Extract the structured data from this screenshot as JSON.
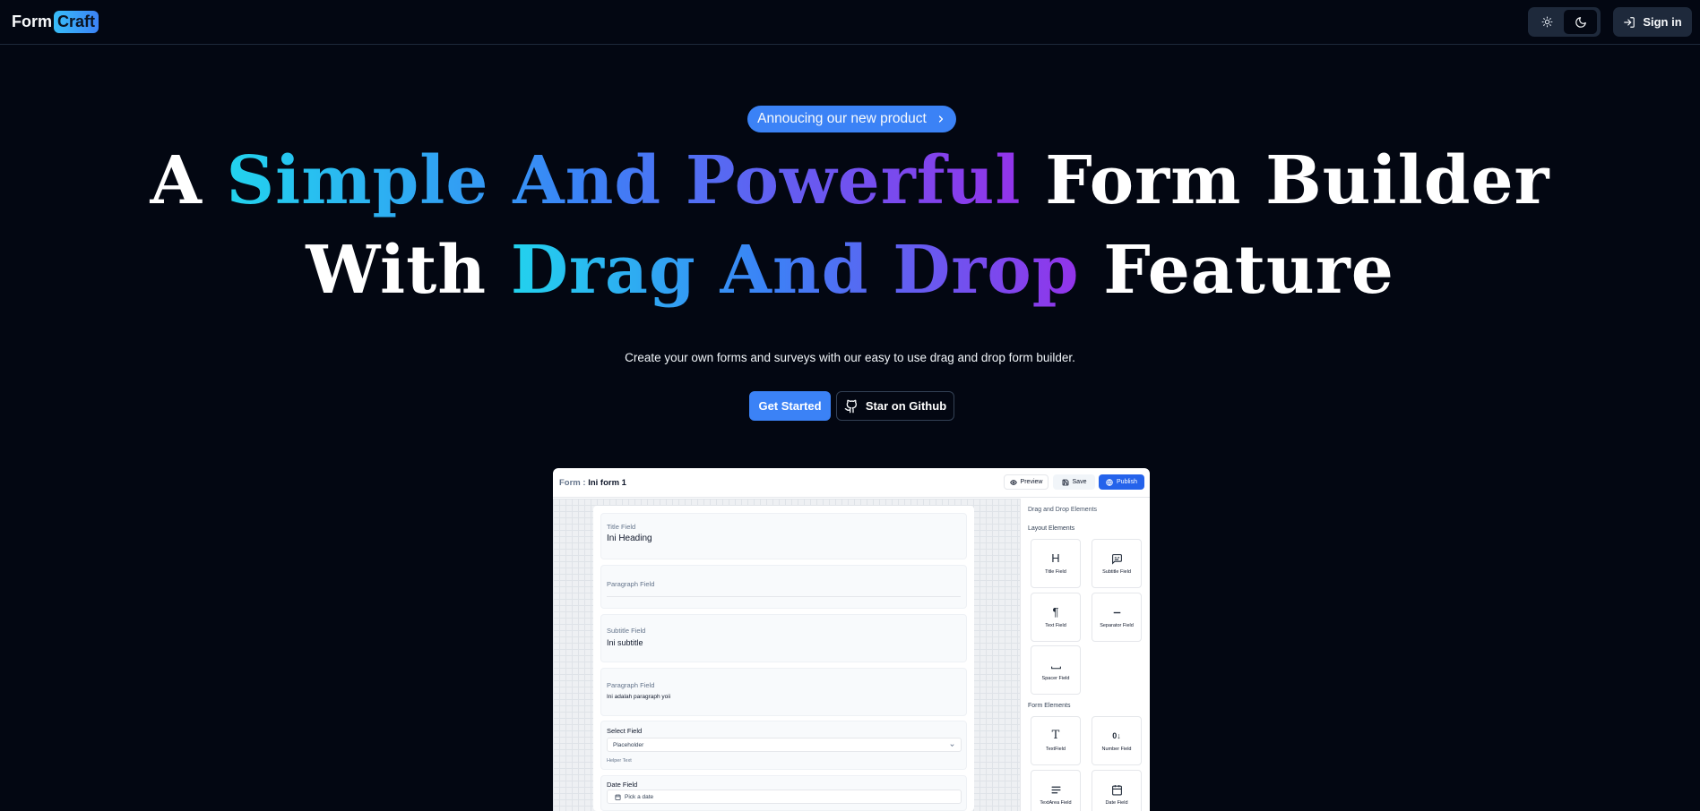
{
  "nav": {
    "logo_form": "Form",
    "logo_craft": "Craft",
    "signin_label": "Sign in"
  },
  "hero": {
    "badge": "Annoucing our new product",
    "headline_line1": [
      "A",
      "Simple And Powerful",
      "Form Builder"
    ],
    "headline_line2": [
      "With",
      "Drag And Drop",
      "Feature"
    ],
    "subtitle": "Create your own forms and surveys with our easy to use drag and drop form builder.",
    "cta_primary": "Get Started",
    "cta_secondary": "Star on Github"
  },
  "preview": {
    "form_prefix": "Form :",
    "form_name": "Ini form 1",
    "btn_preview": "Preview",
    "btn_save": "Save",
    "btn_publish": "Publish",
    "fields": [
      {
        "label": "Title Field",
        "value": "Ini Heading"
      },
      {
        "label": "Paragraph Field",
        "value": ""
      },
      {
        "label": "Subtitle Field",
        "value": "Ini subtitle"
      },
      {
        "label": "Paragraph Field",
        "value": "Ini adalah paragraph yoii"
      },
      {
        "label": "Select Field",
        "placeholder": "Placeholder",
        "helper": "Helper Text"
      },
      {
        "label": "Date Field",
        "placeholder": "Pick a date"
      }
    ],
    "sidebar": {
      "title": "Drag and Drop Elements",
      "layout_heading": "Layout Elements",
      "form_heading": "Form Elements",
      "layout_elements": [
        "Title Field",
        "Subtitle Field",
        "Text Field",
        "Separator Field",
        "Spacer Field"
      ],
      "form_elements": [
        "TextField",
        "Number Field",
        "TextArea Field",
        "Date Field"
      ]
    }
  },
  "colors": {
    "background": "#030712",
    "accent": "#3b82f6",
    "gradient_start": "#22d3ee",
    "gradient_end": "#9333ea"
  },
  "icons": [
    "sun-icon",
    "moon-icon",
    "sign-in-icon",
    "chevron-right-icon",
    "github-icon",
    "eye-icon",
    "save-icon",
    "globe-icon",
    "chevron-down-icon",
    "calendar-icon",
    "heading-icon",
    "subtitle-icon",
    "pilcrow-icon",
    "separator-icon",
    "spacer-icon",
    "text-icon",
    "number-icon",
    "textarea-icon"
  ]
}
